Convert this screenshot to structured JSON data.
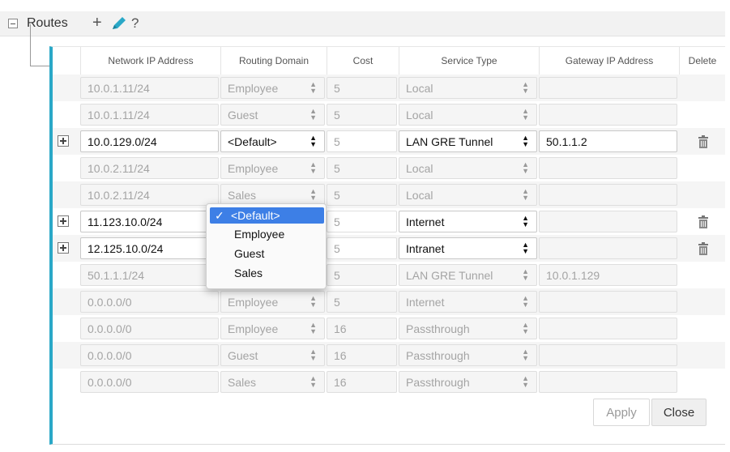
{
  "header": {
    "title": "Routes",
    "add_label": "+",
    "help_label": "?"
  },
  "columns": [
    "Network IP Address",
    "Routing Domain",
    "Cost",
    "Service Type",
    "Gateway IP Address",
    "Delete"
  ],
  "rows": [
    {
      "ip": "10.0.1.11/24",
      "domain": "Employee",
      "cost": "5",
      "service": "Local",
      "gateway": "",
      "editable": false
    },
    {
      "ip": "10.0.1.11/24",
      "domain": "Guest",
      "cost": "5",
      "service": "Local",
      "gateway": "",
      "editable": false
    },
    {
      "ip": "10.0.129.0/24",
      "domain": "<Default>",
      "cost": "5",
      "service": "LAN GRE Tunnel",
      "gateway": "50.1.1.2",
      "editable": true
    },
    {
      "ip": "10.0.2.11/24",
      "domain": "Employee",
      "cost": "5",
      "service": "Local",
      "gateway": "",
      "editable": false
    },
    {
      "ip": "10.0.2.11/24",
      "domain": "Sales",
      "cost": "5",
      "service": "Local",
      "gateway": "",
      "editable": false
    },
    {
      "ip": "11.123.10.0/24",
      "domain": "",
      "cost": "5",
      "service": "Internet",
      "gateway": "",
      "editable": true
    },
    {
      "ip": "12.125.10.0/24",
      "domain": "",
      "cost": "5",
      "service": "Intranet",
      "gateway": "",
      "editable": true
    },
    {
      "ip": "50.1.1.1/24",
      "domain": "",
      "cost": "5",
      "service": "LAN GRE Tunnel",
      "gateway": "10.0.1.129",
      "editable": false
    },
    {
      "ip": "0.0.0.0/0",
      "domain": "Employee",
      "cost": "5",
      "service": "Internet",
      "gateway": "",
      "editable": false
    },
    {
      "ip": "0.0.0.0/0",
      "domain": "Employee",
      "cost": "16",
      "service": "Passthrough",
      "gateway": "",
      "editable": false
    },
    {
      "ip": "0.0.0.0/0",
      "domain": "Guest",
      "cost": "16",
      "service": "Passthrough",
      "gateway": "",
      "editable": false
    },
    {
      "ip": "0.0.0.0/0",
      "domain": "Sales",
      "cost": "16",
      "service": "Passthrough",
      "gateway": "",
      "editable": false
    }
  ],
  "dropdown": {
    "selected": "<Default>",
    "check": "✓",
    "options": [
      "<Default>",
      "Employee",
      "Guest",
      "Sales"
    ]
  },
  "actions": {
    "apply_label": "Apply",
    "close_label": "Close"
  },
  "colors": {
    "accent": "#2aa8c7",
    "selection": "#3d7fe6"
  }
}
